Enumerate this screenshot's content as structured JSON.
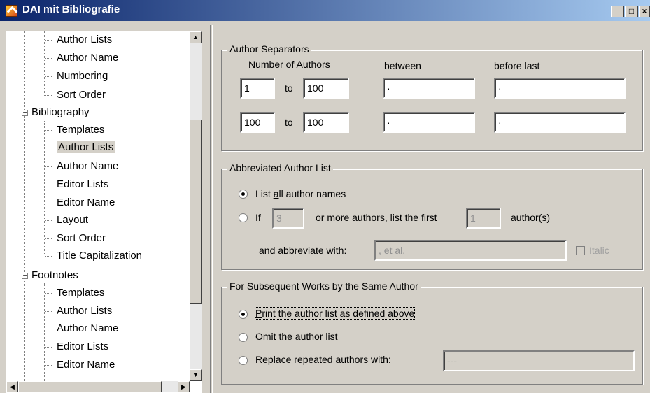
{
  "window": {
    "title": "DAI mit Bibliografie"
  },
  "tree": {
    "items": [
      {
        "label": "Author Lists"
      },
      {
        "label": "Author Name"
      },
      {
        "label": "Numbering"
      },
      {
        "label": "Sort Order"
      },
      {
        "label": "Bibliography"
      },
      {
        "label": "Templates"
      },
      {
        "label": "Author Lists"
      },
      {
        "label": "Author Name"
      },
      {
        "label": "Editor Lists"
      },
      {
        "label": "Editor Name"
      },
      {
        "label": "Layout"
      },
      {
        "label": "Sort Order"
      },
      {
        "label": "Title Capitalization"
      },
      {
        "label": "Footnotes"
      },
      {
        "label": "Templates"
      },
      {
        "label": "Author Lists"
      },
      {
        "label": "Author Name"
      },
      {
        "label": "Editor Lists"
      },
      {
        "label": "Editor Name"
      }
    ]
  },
  "separators": {
    "legend": "Author Separators",
    "col_number": "Number of Authors",
    "col_between": "between",
    "col_before_last": "before last",
    "to": "to",
    "rows": [
      {
        "from": "1",
        "to": "100",
        "between": "·",
        "before_last": "·"
      },
      {
        "from": "100",
        "to": "100",
        "between": "·",
        "before_last": "·"
      }
    ]
  },
  "abbrev": {
    "legend": "Abbreviated Author List",
    "opt1_pre": "List ",
    "opt1_ul": "a",
    "opt1_post": "ll author names",
    "opt2_ul": "I",
    "opt2_post": "f",
    "min_authors": "3",
    "or_more_pre": "or more authors, list the fi",
    "or_more_ul": "r",
    "or_more_post": "st",
    "first_n": "1",
    "authors_suffix": "author(s)",
    "abbr_pre": "and abbreviate ",
    "abbr_ul": "w",
    "abbr_post": "ith:",
    "abbr_value": ", et al.",
    "italic": "Italic"
  },
  "subsequent": {
    "legend": "For Subsequent Works by the Same Author",
    "opt1_ul": "P",
    "opt1_post": "rint the author list as defined above",
    "opt2_ul": "O",
    "opt2_post": "mit the author list",
    "opt3_pre": "R",
    "opt3_ul": "e",
    "opt3_post": "place repeated authors with:",
    "replace_value": "---"
  }
}
